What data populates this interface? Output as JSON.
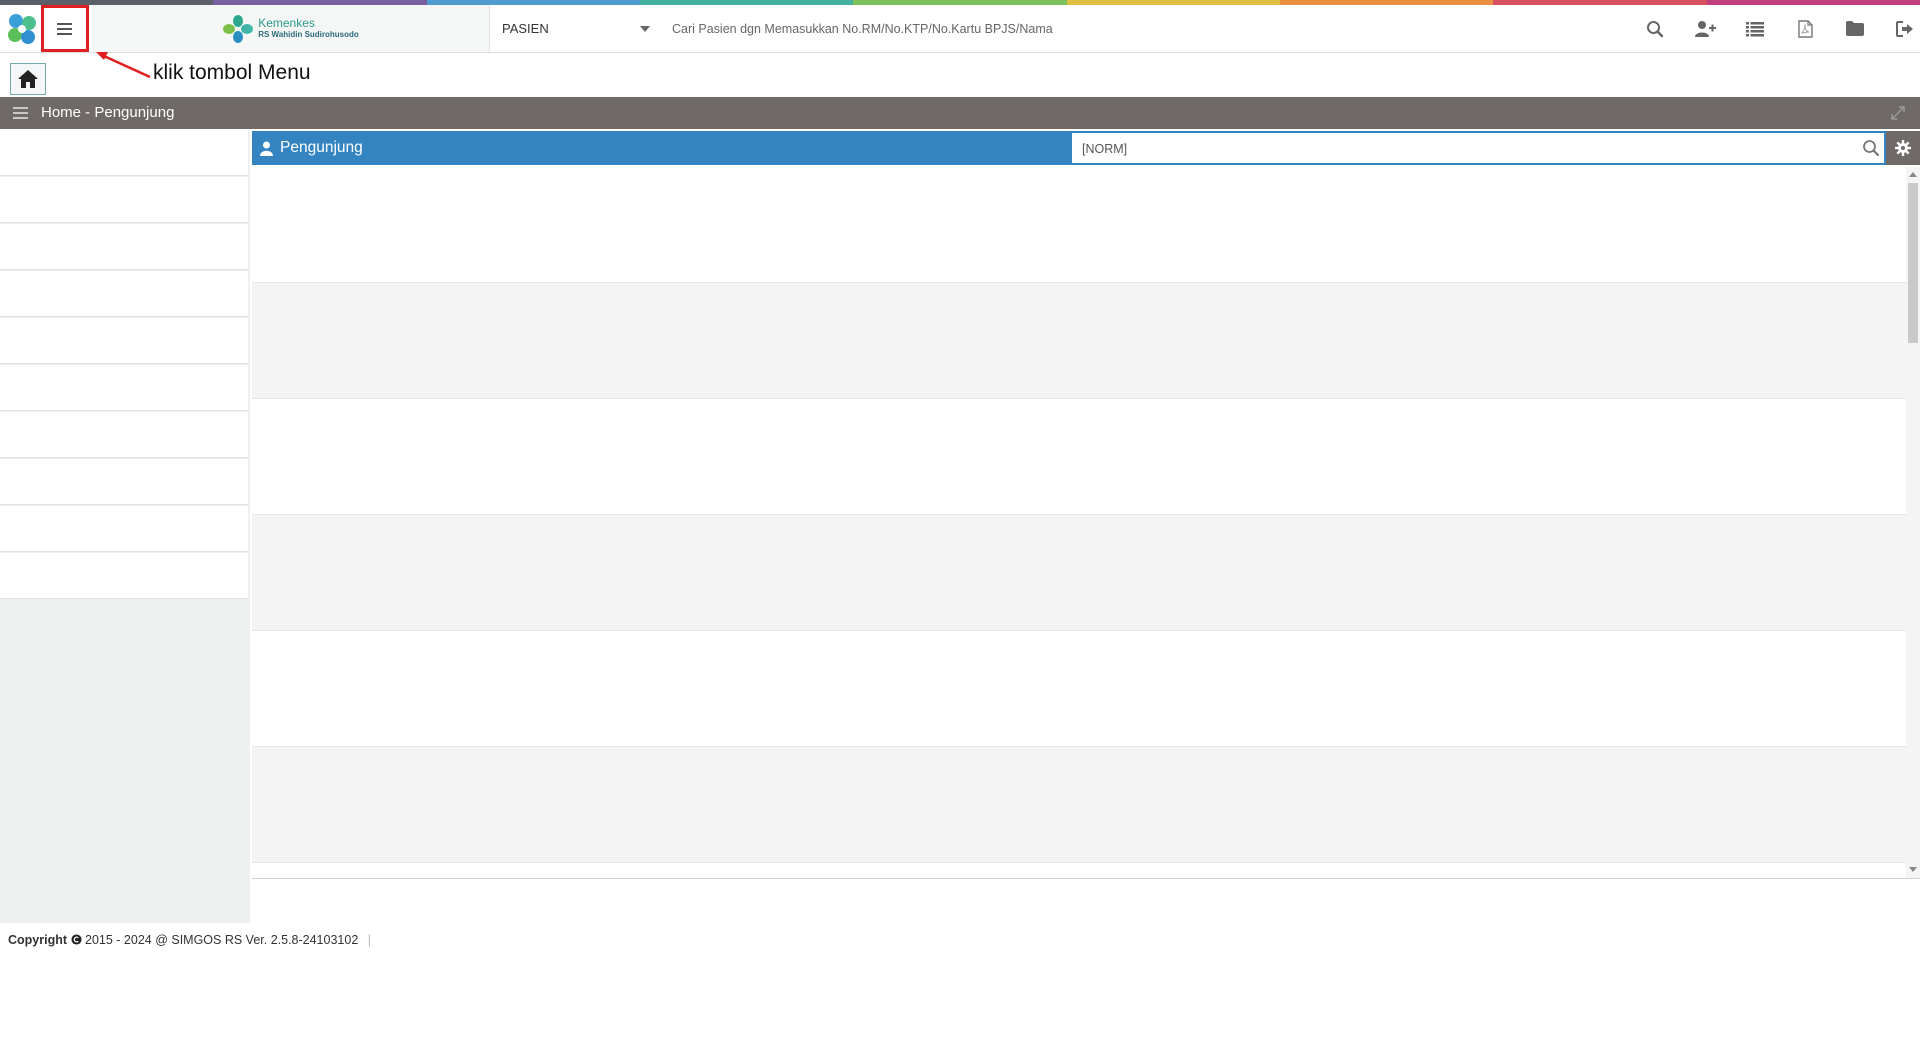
{
  "rainbow_colors": [
    "#5a5f6a",
    "#7a5fa0",
    "#4f9ad0",
    "#44b0a0",
    "#7cc05a",
    "#e0c040",
    "#e89040",
    "#d85060",
    "#c04080"
  ],
  "header": {
    "brand_title": "Kemenkes",
    "brand_subtitle": "RS Wahidin Sudirohusodo",
    "patient_select_value": "PASIEN",
    "search_placeholder": "Cari Pasien dgn Memasukkan No.RM/No.KTP/No.Kartu BPJS/Nama",
    "icons": [
      "search-icon",
      "user-plus-icon",
      "list-icon",
      "pdf-file-icon",
      "folder-icon",
      "sign-out-icon"
    ]
  },
  "annotation": {
    "text": "klik tombol Menu",
    "color": "#e02020"
  },
  "breadcrumb": {
    "text": "Home - Pengunjung"
  },
  "panel": {
    "title": "Pengunjung",
    "norm_placeholder": "[NORM]",
    "accent_color": "#3384c1"
  },
  "sidebar": {
    "item_count": 10
  },
  "content": {
    "row_colors": [
      "#ffffff",
      "#f4f4f4",
      "#ffffff",
      "#f4f4f4",
      "#ffffff",
      "#f4f4f4"
    ]
  },
  "footer": {
    "copyright_label": "Copyright",
    "copyright_text": "2015 - 2024 @ SIMGOS RS Ver. 2.5.8-24103102",
    "separator": "|"
  }
}
